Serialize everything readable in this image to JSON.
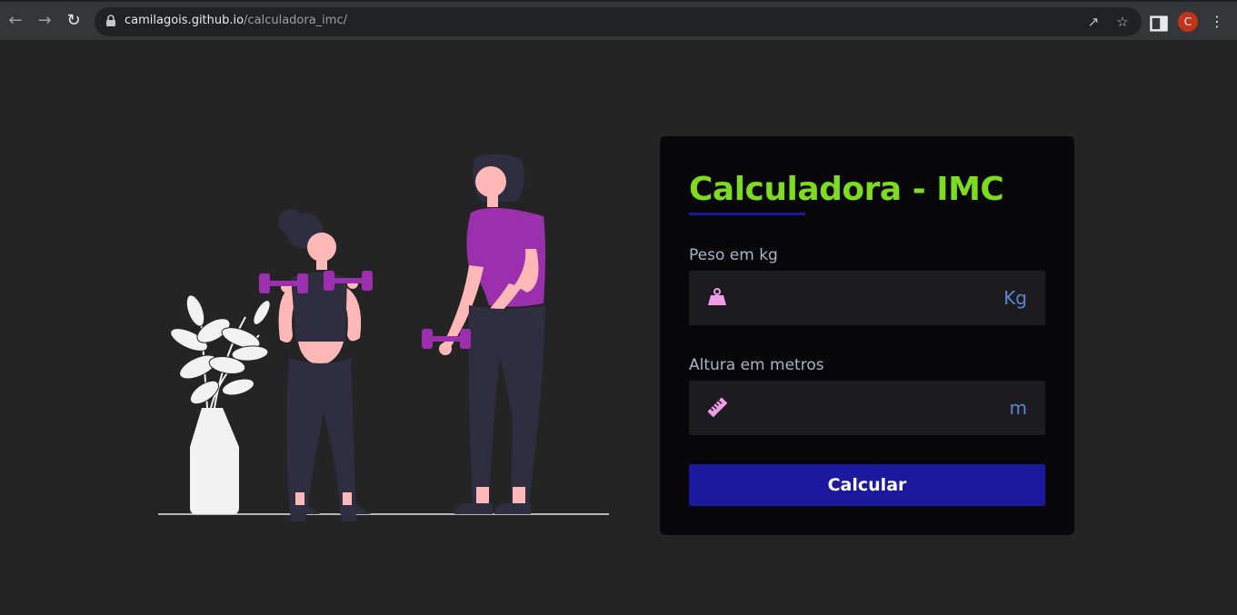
{
  "browser": {
    "url_domain": "camilagois.github.io",
    "url_path": "/calculadora_imc/",
    "profile_initial": "C",
    "icons": [
      "back-arrow-icon",
      "forward-arrow-icon",
      "reload-icon",
      "lock-icon",
      "share-icon",
      "star-icon",
      "side-panel-icon",
      "kebab-menu-icon"
    ]
  },
  "card": {
    "title": "Calculadora - IMC",
    "title_color": "#7ddc1f",
    "accent_color": "#1b1a9e",
    "weight": {
      "label": "Peso em kg",
      "unit": "Kg",
      "value": "",
      "icon": "weight-icon"
    },
    "height": {
      "label": "Altura em metros",
      "unit": "m",
      "value": "",
      "icon": "ruler-icon"
    },
    "button_label": "Calcular"
  },
  "illustration": {
    "icons": [
      "woman-lifting-dumbbells",
      "woman-holding-dumbbell",
      "potted-plant"
    ],
    "colors": {
      "shirt": "#9b2fae",
      "skin": "#ffb8b8",
      "dark": "#2f2e41",
      "plant": "#f2f2f2"
    }
  }
}
